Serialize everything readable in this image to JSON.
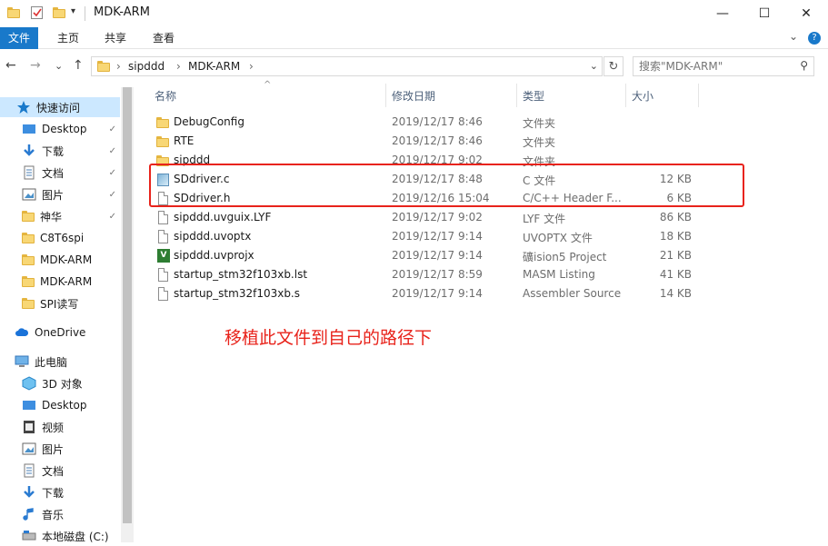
{
  "window": {
    "title": "MDK-ARM",
    "minimize": "—",
    "maximize": "☐",
    "close": "✕"
  },
  "ribbon": {
    "tabs": [
      {
        "label": "文件"
      },
      {
        "label": "主页"
      },
      {
        "label": "共享"
      },
      {
        "label": "查看"
      }
    ],
    "expand": "⌄",
    "help": "?"
  },
  "nav": {
    "back": "←",
    "forward": "→",
    "recent": "⌄",
    "up": "↑",
    "breadcrumb": [
      "sipddd",
      "MDK-ARM"
    ],
    "sep": "›",
    "dropdown": "⌄",
    "refresh": "↻",
    "search_placeholder": "搜索\"MDK-ARM\"",
    "search_icon": "⚲"
  },
  "sidebar": {
    "items": [
      {
        "label": "快速访问",
        "icon": "star-icon",
        "selected": true
      },
      {
        "label": "Desktop",
        "icon": "desktop-icon",
        "pin": true
      },
      {
        "label": "下载",
        "icon": "download-icon",
        "pin": true
      },
      {
        "label": "文档",
        "icon": "document-icon",
        "pin": true
      },
      {
        "label": "图片",
        "icon": "picture-icon",
        "pin": true
      },
      {
        "label": "神华",
        "icon": "folder-icon",
        "pin": true
      },
      {
        "label": "C8T6spi",
        "icon": "folder-icon"
      },
      {
        "label": "MDK-ARM",
        "icon": "folder-icon"
      },
      {
        "label": "MDK-ARM",
        "icon": "folder-icon"
      },
      {
        "label": "SPI读写",
        "icon": "folder-icon"
      },
      {
        "label": "OneDrive",
        "icon": "cloud-icon"
      },
      {
        "label": "此电脑",
        "icon": "computer-icon"
      },
      {
        "label": "3D 对象",
        "icon": "cube-icon"
      },
      {
        "label": "Desktop",
        "icon": "desktop-icon"
      },
      {
        "label": "视频",
        "icon": "video-icon"
      },
      {
        "label": "图片",
        "icon": "picture-icon"
      },
      {
        "label": "文档",
        "icon": "document-icon"
      },
      {
        "label": "下载",
        "icon": "download-icon"
      },
      {
        "label": "音乐",
        "icon": "music-icon"
      },
      {
        "label": "本地磁盘 (C:)",
        "icon": "drive-icon"
      }
    ],
    "pin_glyph": "📌"
  },
  "columns": {
    "name": "名称",
    "date": "修改日期",
    "type": "类型",
    "size": "大小",
    "sort_glyph": "^"
  },
  "files": [
    {
      "name": "DebugConfig",
      "date": "2019/12/17 8:46",
      "type": "文件夹",
      "size": "",
      "icon": "folder-icon"
    },
    {
      "name": "RTE",
      "date": "2019/12/17 8:46",
      "type": "文件夹",
      "size": "",
      "icon": "folder-icon"
    },
    {
      "name": "sipddd",
      "date": "2019/12/17 9:02",
      "type": "文件夹",
      "size": "",
      "icon": "folder-icon"
    },
    {
      "name": "SDdriver.c",
      "date": "2019/12/17 8:48",
      "type": "C 文件",
      "size": "12 KB",
      "icon": "c-file-icon"
    },
    {
      "name": "SDdriver.h",
      "date": "2019/12/16 15:04",
      "type": "C/C++ Header F...",
      "size": "6 KB",
      "icon": "file-icon"
    },
    {
      "name": "sipddd.uvguix.LYF",
      "date": "2019/12/17 9:02",
      "type": "LYF 文件",
      "size": "86 KB",
      "icon": "file-icon"
    },
    {
      "name": "sipddd.uvoptx",
      "date": "2019/12/17 9:14",
      "type": "UVOPTX 文件",
      "size": "18 KB",
      "icon": "file-icon"
    },
    {
      "name": "sipddd.uvprojx",
      "date": "2019/12/17 9:14",
      "type": "礦ision5 Project",
      "size": "21 KB",
      "icon": "uvision-icon",
      "badge": "V"
    },
    {
      "name": "startup_stm32f103xb.lst",
      "date": "2019/12/17 8:59",
      "type": "MASM Listing",
      "size": "41 KB",
      "icon": "file-icon"
    },
    {
      "name": "startup_stm32f103xb.s",
      "date": "2019/12/17 9:14",
      "type": "Assembler Source",
      "size": "14 KB",
      "icon": "file-icon"
    }
  ],
  "annotation": "移植此文件到自己的路径下",
  "colors": {
    "accent": "#1979ca",
    "selected": "#cce8ff",
    "annotation": "#e8231b"
  }
}
